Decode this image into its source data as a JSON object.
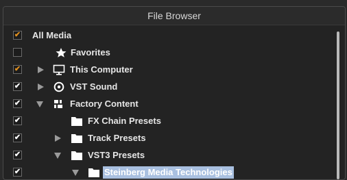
{
  "header": {
    "title": "File Browser"
  },
  "tree": {
    "items": [
      {
        "label": "All Media",
        "checkbox": "orange",
        "arrow": "none",
        "icon": "none"
      },
      {
        "label": "Favorites",
        "checkbox": "empty",
        "arrow": "none",
        "icon": "star-icon"
      },
      {
        "label": "This Computer",
        "checkbox": "orange",
        "arrow": "right",
        "icon": "monitor-icon"
      },
      {
        "label": "VST Sound",
        "checkbox": "white",
        "arrow": "right",
        "icon": "disc-icon"
      },
      {
        "label": "Factory Content",
        "checkbox": "white",
        "arrow": "down",
        "icon": "blocks-icon"
      },
      {
        "label": "FX Chain Presets",
        "checkbox": "white",
        "arrow": "none",
        "icon": "folder-icon"
      },
      {
        "label": "Track Presets",
        "checkbox": "white",
        "arrow": "right",
        "icon": "folder-icon"
      },
      {
        "label": "VST3 Presets",
        "checkbox": "white",
        "arrow": "down",
        "icon": "folder-icon"
      },
      {
        "label": "Steinberg Media Technologies",
        "checkbox": "white",
        "arrow": "down",
        "icon": "folder-icon",
        "selected": true
      }
    ]
  },
  "colors": {
    "selection": "#a9c0e0",
    "checkmark_partial": "#e09020"
  }
}
